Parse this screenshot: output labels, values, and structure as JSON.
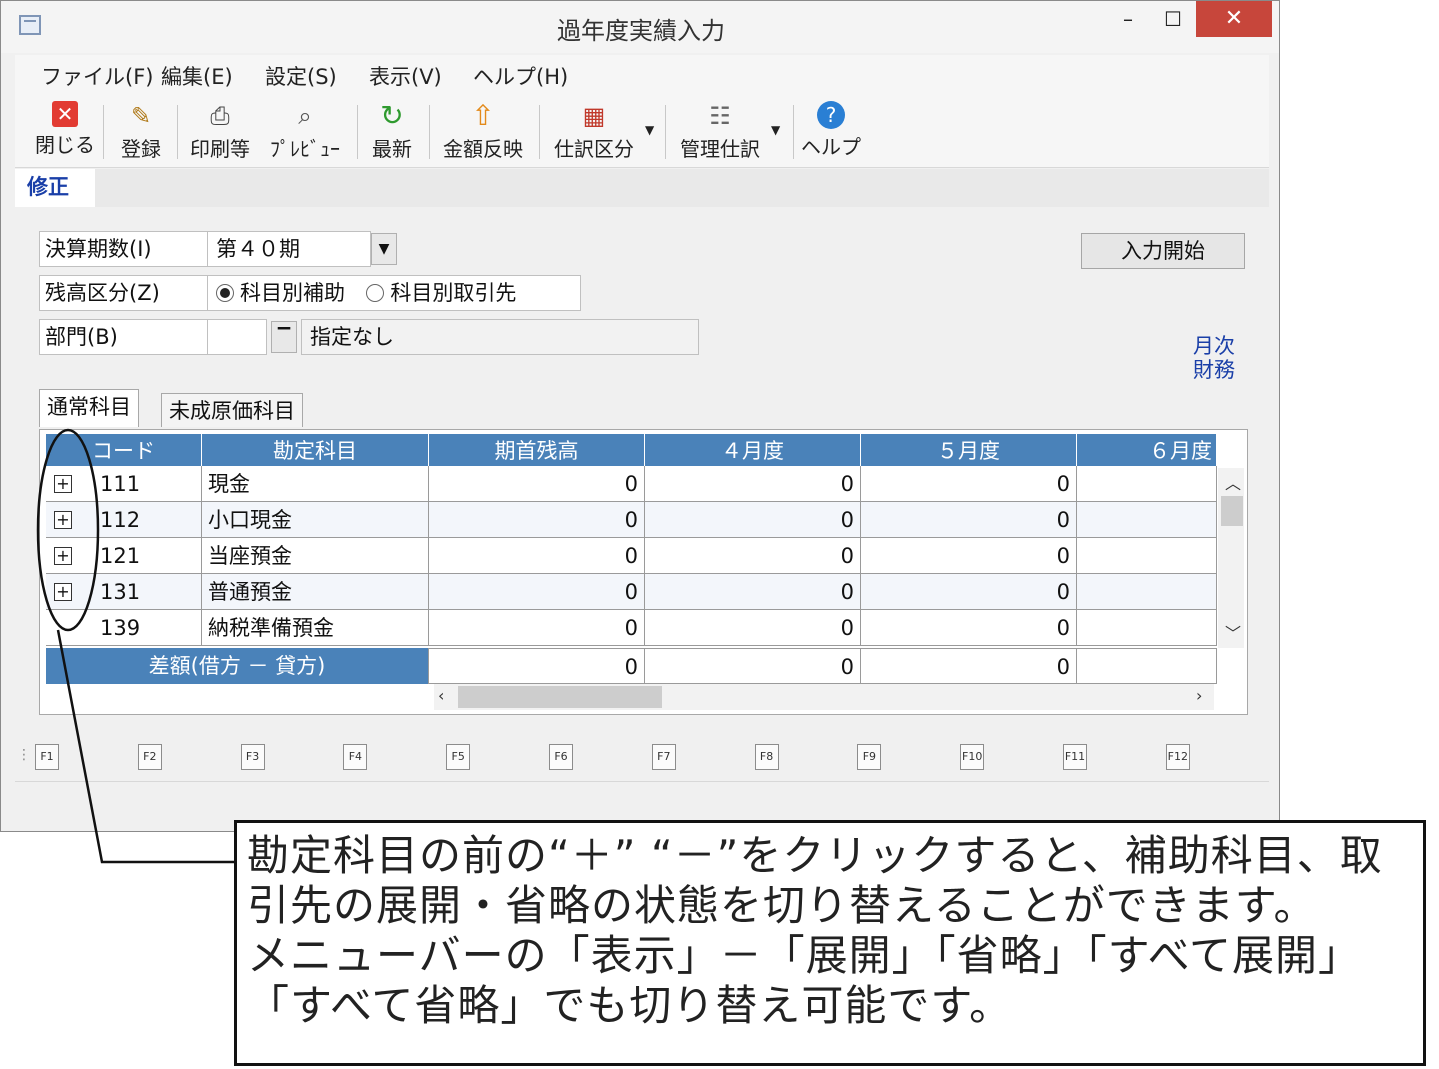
{
  "window": {
    "title": "過年度実績入力",
    "min": "–",
    "max": "☐",
    "close": "✕"
  },
  "menu": [
    "ファイル(F)",
    "編集(E)",
    "設定(S)",
    "表示(V)",
    "ヘルプ(H)"
  ],
  "toolbar": [
    {
      "label": "閉じる",
      "icon": "close-icon"
    },
    {
      "label": "登録",
      "icon": "register-icon"
    },
    {
      "label": "印刷等",
      "icon": "printer-icon"
    },
    {
      "label": "ﾌﾟﾚﾋﾞｭｰ",
      "icon": "preview-icon"
    },
    {
      "label": "最新",
      "icon": "refresh-icon"
    },
    {
      "label": "金額反映",
      "icon": "upload-icon"
    },
    {
      "label": "仕訳区分",
      "icon": "calendar-icon"
    },
    {
      "label": "管理仕訳",
      "icon": "checklist-icon"
    },
    {
      "label": "ヘルプ",
      "icon": "help-icon"
    }
  ],
  "mode_tab": "修正",
  "form": {
    "period_label": "決算期数(I)",
    "period_value": "第４０期",
    "balance_label": "残高区分(Z)",
    "radio1": "科目別補助",
    "radio2": "科目別取引先",
    "dept_label": "部門(B)",
    "dept_code": "",
    "dept_name": "指定なし",
    "start_button": "入力開始",
    "link1": "月次",
    "link2": "財務"
  },
  "tabs": [
    "通常科目",
    "未成原価科目"
  ],
  "grid": {
    "headers": [
      "コード",
      "勘定科目",
      "期首残高",
      "４月度",
      "５月度",
      "６月度"
    ],
    "rows": [
      {
        "code": "111",
        "name": "現金",
        "v0": "0",
        "v1": "0",
        "v2": "0",
        "expandable": true
      },
      {
        "code": "112",
        "name": "小口現金",
        "v0": "0",
        "v1": "0",
        "v2": "0",
        "expandable": true
      },
      {
        "code": "121",
        "name": "当座預金",
        "v0": "0",
        "v1": "0",
        "v2": "0",
        "expandable": true
      },
      {
        "code": "131",
        "name": "普通預金",
        "v0": "0",
        "v1": "0",
        "v2": "0",
        "expandable": true
      },
      {
        "code": "139",
        "name": "納税準備預金",
        "v0": "0",
        "v1": "0",
        "v2": "0",
        "expandable": false
      }
    ],
    "summary_label": "差額(借方 － 貸方)",
    "summary": [
      "0",
      "0",
      "0"
    ]
  },
  "fkeys": [
    "F1",
    "F2",
    "F3",
    "F4",
    "F5",
    "F6",
    "F7",
    "F8",
    "F9",
    "F10",
    "F11",
    "F12"
  ],
  "callout": [
    "勘定科目の前の“＋” “－”をクリックすると、補助科目、取",
    "引先の展開・省略の状態を切り替えることができます。",
    "メニューバーの「表示」－「展開」「省略」「すべて展開」",
    "「すべて省略」でも切り替え可能です。"
  ]
}
